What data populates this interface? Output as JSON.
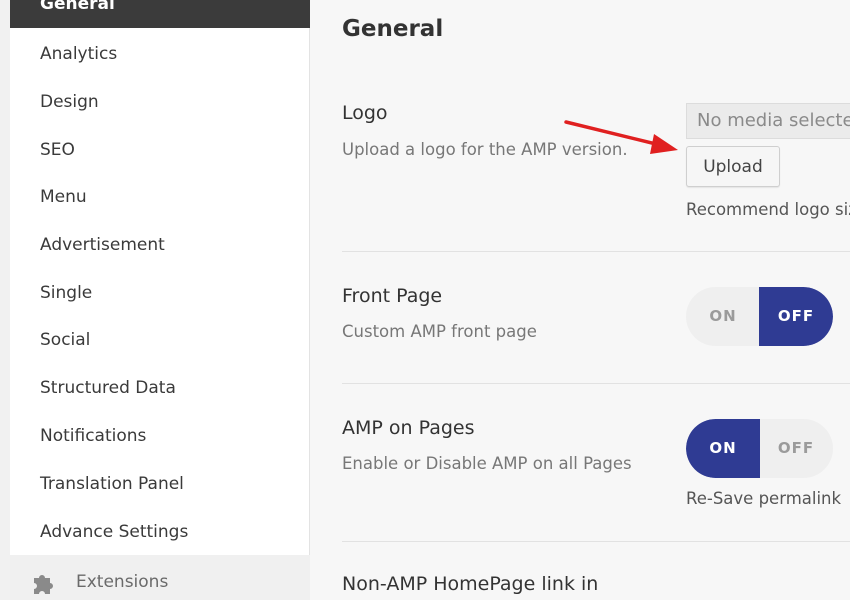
{
  "sidebar": {
    "items": [
      {
        "label": "General",
        "active": true
      },
      {
        "label": "Analytics"
      },
      {
        "label": "Design"
      },
      {
        "label": "SEO"
      },
      {
        "label": "Menu"
      },
      {
        "label": "Advertisement"
      },
      {
        "label": "Single"
      },
      {
        "label": "Social"
      },
      {
        "label": "Structured Data"
      },
      {
        "label": "Notifications"
      },
      {
        "label": "Translation Panel"
      },
      {
        "label": "Advance Settings"
      }
    ],
    "extensions": {
      "label": "Extensions",
      "icon": "puzzle-icon"
    }
  },
  "main": {
    "title": "General",
    "logo": {
      "title": "Logo",
      "description": "Upload a logo for the AMP version.",
      "media_placeholder": "No media selected",
      "upload_label": "Upload",
      "help": "Recommend logo size"
    },
    "front_page": {
      "title": "Front Page",
      "description": "Custom AMP front page",
      "toggle": {
        "on": "ON",
        "off": "OFF",
        "state": "OFF"
      }
    },
    "amp_pages": {
      "title": "AMP on Pages",
      "description": "Enable or Disable AMP on all Pages",
      "toggle": {
        "on": "ON",
        "off": "OFF",
        "state": "ON"
      },
      "help": "Re-Save permalink"
    },
    "nonamp": {
      "title": "Non-AMP HomePage link in"
    }
  },
  "colors": {
    "toggle_active": "#2f3b93",
    "sidebar_active": "#3b3b3b",
    "arrow": "#e02020"
  }
}
